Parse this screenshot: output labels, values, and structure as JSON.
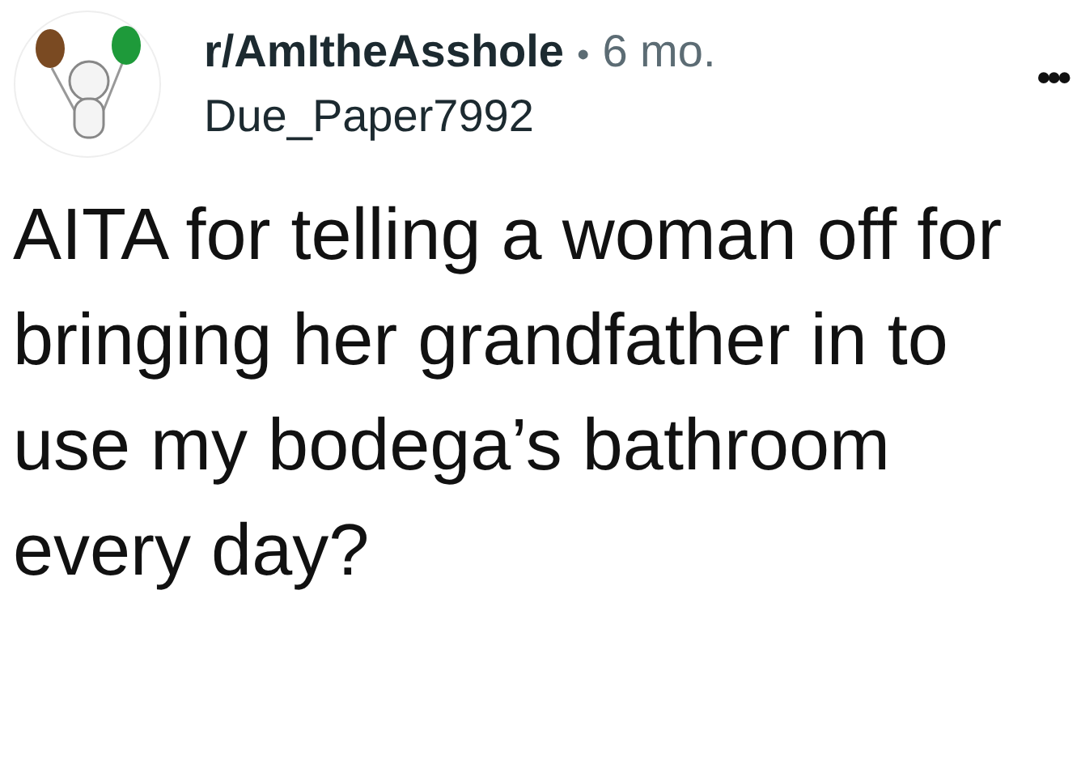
{
  "post": {
    "subreddit": "r/AmItheAsshole",
    "separator": "•",
    "age": "6 mo.",
    "author": "Due_Paper7992",
    "menu": "•••",
    "title": "AITA for telling a woman off for bringing her grandfather in to use my bodega’s bathroom every day?"
  }
}
